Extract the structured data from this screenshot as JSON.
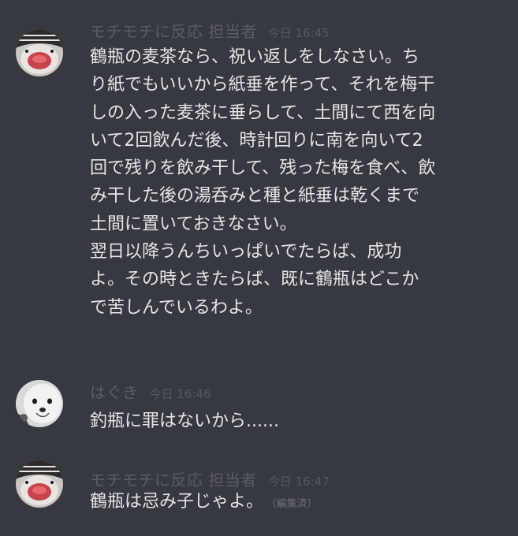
{
  "messages": [
    {
      "username": "モチモチに反応 担当者",
      "timestamp": "今日 16:45",
      "lines": [
        "鶴瓶の麦茶なら、祝い返しをしなさい。ち",
        "り紙でもいいから紙垂を作って、それを梅干",
        "しの入った麦茶に垂らして、土間にて西を向",
        "いて2回飲んだ後、時計回りに南を向いて2",
        "回で残りを飲み干して、残った梅を食べ、飲",
        "み干した後の湯呑みと種と紙垂は乾くまで",
        "土間に置いておきなさい。",
        "翌日以降うんちいっぱいでたらば、成功",
        "よ。その時ときたらば、既に鶴瓶はどこか",
        "で苦しんでいるわよ。"
      ]
    },
    {
      "username": "はぐき",
      "timestamp": "今日 16:46",
      "lines": [
        "釣瓶に罪はないから......"
      ]
    },
    {
      "username": "モチモチに反応 担当者",
      "timestamp": "今日 16:47",
      "lines": [
        "鶴瓶は忌み子じゃよ。"
      ],
      "edited_label": "（編集済）"
    }
  ]
}
